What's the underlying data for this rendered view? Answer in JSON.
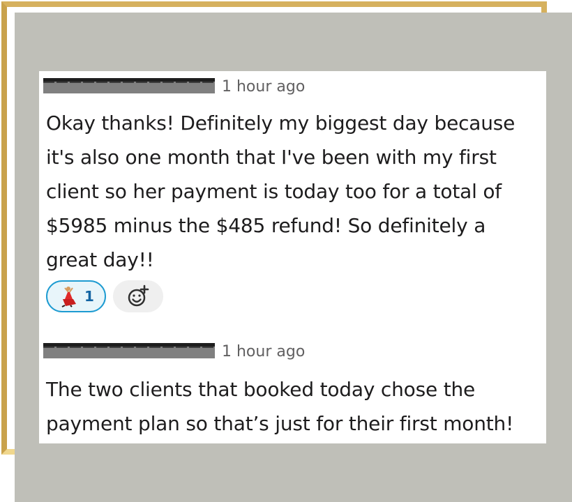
{
  "messages": [
    {
      "timestamp": "1 hour ago",
      "text": "Okay thanks! Definitely my biggest day because\nit's also one month that I've been with my first\nclient so her payment is today too for a total of\n$5985 minus the $485 refund! So definitely a\ngreat day!!",
      "reaction": {
        "icon": "dancer-icon",
        "count": "1"
      },
      "add_reaction_icon": "add-reaction-icon"
    },
    {
      "timestamp": "1 hour ago",
      "text": "The two clients that booked today chose the\npayment plan so that’s just for their first month!"
    }
  ],
  "colors": {
    "frame_gold": "#d6b15e",
    "card_gray": "#bfbfb8",
    "reaction_blue": "#1d9bd1",
    "timestamp_gray": "#616061"
  }
}
